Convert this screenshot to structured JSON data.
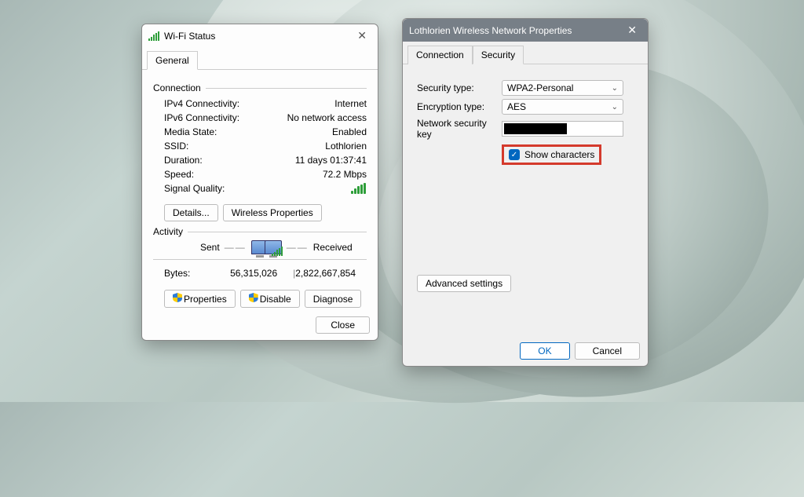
{
  "wifi_status": {
    "title": "Wi-Fi Status",
    "tab_general": "General",
    "group_connection": "Connection",
    "ipv4_label": "IPv4 Connectivity:",
    "ipv4_value": "Internet",
    "ipv6_label": "IPv6 Connectivity:",
    "ipv6_value": "No network access",
    "media_label": "Media State:",
    "media_value": "Enabled",
    "ssid_label": "SSID:",
    "ssid_value": "Lothlorien",
    "duration_label": "Duration:",
    "duration_value": "11 days 01:37:41",
    "speed_label": "Speed:",
    "speed_value": "72.2 Mbps",
    "signal_label": "Signal Quality:",
    "btn_details": "Details...",
    "btn_wprops": "Wireless Properties",
    "group_activity": "Activity",
    "sent_label": "Sent",
    "received_label": "Received",
    "bytes_label": "Bytes:",
    "bytes_sent": "56,315,026",
    "bytes_recv": "2,822,667,854",
    "btn_properties": "Properties",
    "btn_disable": "Disable",
    "btn_diagnose": "Diagnose",
    "btn_close": "Close"
  },
  "net_props": {
    "title": "Lothlorien Wireless Network Properties",
    "tab_connection": "Connection",
    "tab_security": "Security",
    "sectype_label": "Security type:",
    "sectype_value": "WPA2-Personal",
    "enctype_label": "Encryption type:",
    "enctype_value": "AES",
    "key_label": "Network security key",
    "show_chars": "Show characters",
    "btn_advanced": "Advanced settings",
    "btn_ok": "OK",
    "btn_cancel": "Cancel"
  }
}
